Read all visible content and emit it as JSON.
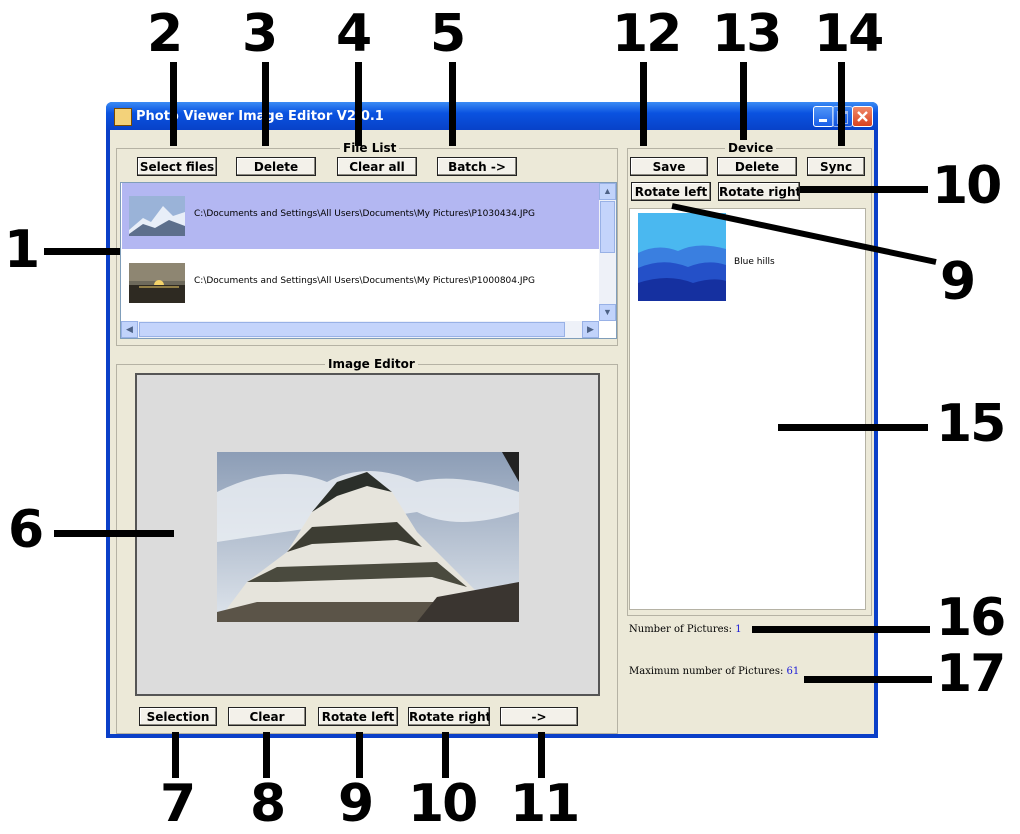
{
  "window": {
    "title": "Photo Viewer Image Editor V2.0.1"
  },
  "file_list": {
    "title": "File List",
    "buttons": {
      "select_files": "Select files",
      "delete": "Delete",
      "clear_all": "Clear all",
      "batch": "Batch ->"
    },
    "items": [
      {
        "path": "C:\\Documents and Settings\\All Users\\Documents\\My Pictures\\P1030434.JPG",
        "selected": true
      },
      {
        "path": "C:\\Documents and Settings\\All Users\\Documents\\My Pictures\\P1000804.JPG",
        "selected": false
      }
    ]
  },
  "image_editor": {
    "title": "Image Editor",
    "buttons": {
      "selection": "Selection",
      "clear": "Clear",
      "rotate_left": "Rotate left",
      "rotate_right": "Rotate right",
      "next": "->"
    }
  },
  "device": {
    "title": "Device",
    "buttons": {
      "save": "Save",
      "delete": "Delete",
      "sync": "Sync",
      "rotate_left": "Rotate left",
      "rotate_right": "Rotate right"
    },
    "pictures": [
      {
        "name": "Blue hills"
      }
    ],
    "number_label": "Number of Pictures:",
    "number_value": "1",
    "max_label": "Maximum number of Pictures:",
    "max_value": "61"
  },
  "callouts": [
    "1",
    "2",
    "3",
    "4",
    "5",
    "6",
    "7",
    "8",
    "9",
    "10",
    "11",
    "12",
    "13",
    "14",
    "15",
    "16",
    "17",
    "9",
    "10"
  ]
}
